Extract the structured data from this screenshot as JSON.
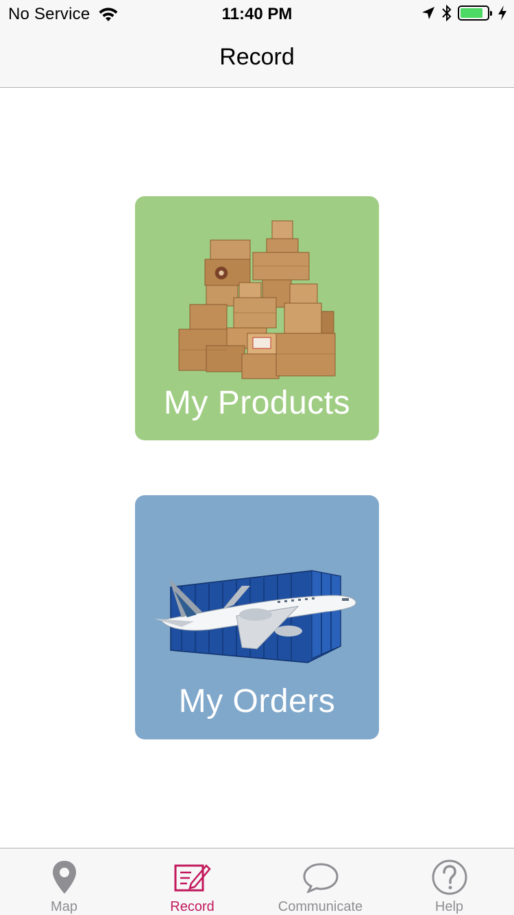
{
  "status_bar": {
    "carrier": "No Service",
    "time": "11:40 PM",
    "battery_level": 0.85,
    "battery_color": "#4cd964"
  },
  "nav": {
    "title": "Record"
  },
  "cards": {
    "products": {
      "label": "My Products",
      "background": "#a0cd84",
      "illustration": "cardboard-boxes"
    },
    "orders": {
      "label": "My Orders",
      "background": "#80a8cb",
      "illustration": "airplane-and-shipping-container"
    }
  },
  "tabbar": {
    "active_color": "#c2185b",
    "inactive_color": "#8e8e93",
    "tabs": [
      {
        "label": "Map",
        "icon": "map-pin-icon",
        "active": false
      },
      {
        "label": "Record",
        "icon": "record-edit-icon",
        "active": true
      },
      {
        "label": "Communicate",
        "icon": "chat-bubble-icon",
        "active": false
      },
      {
        "label": "Help",
        "icon": "help-question-icon",
        "active": false
      }
    ]
  }
}
